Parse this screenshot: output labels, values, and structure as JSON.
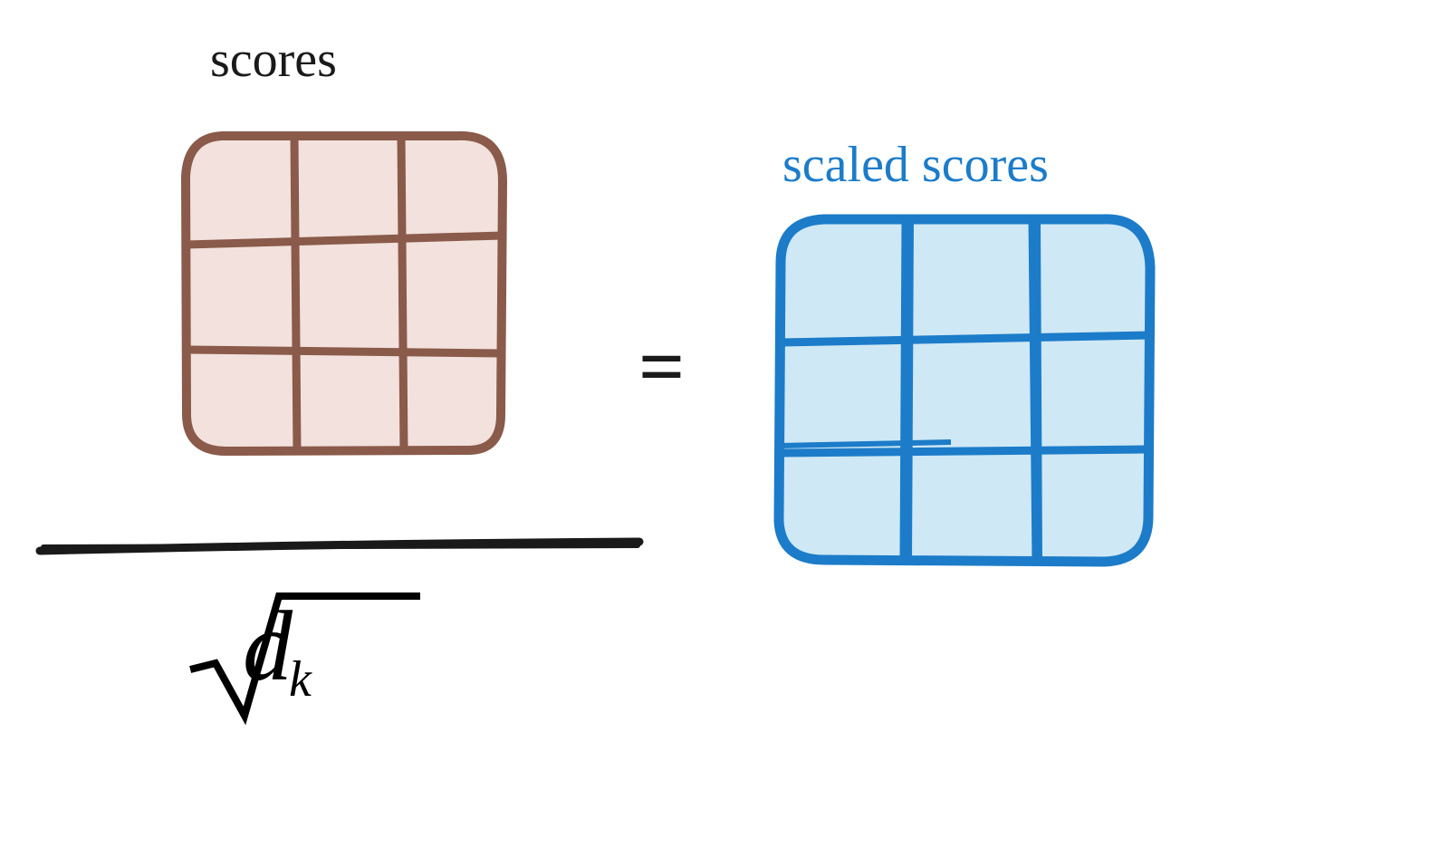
{
  "labels": {
    "scores": "scores",
    "scaled_scores": "scaled scores"
  },
  "equals_symbol": "=",
  "denominator": {
    "radical_arg_main": "d",
    "radical_arg_sub": "k"
  },
  "colors": {
    "scores_stroke": "#8a5a4a",
    "scores_fill": "#f2e1dc",
    "scaled_stroke": "#1c7cc9",
    "scaled_fill": "#cfe8f5",
    "black": "#1a1a1a"
  },
  "diagram": {
    "description": "Scaled dot-product attention scaling step: scores matrix divided by sqrt(d_k) equals scaled scores matrix",
    "elements": [
      {
        "name": "scores-matrix",
        "role": "numerator",
        "grid": "3x3",
        "color": "brown"
      },
      {
        "name": "fraction-bar",
        "role": "divider"
      },
      {
        "name": "sqrt-dk",
        "role": "denominator"
      },
      {
        "name": "equals",
        "role": "operator"
      },
      {
        "name": "scaled-scores-matrix",
        "role": "result",
        "grid": "3x3",
        "color": "blue"
      }
    ]
  }
}
